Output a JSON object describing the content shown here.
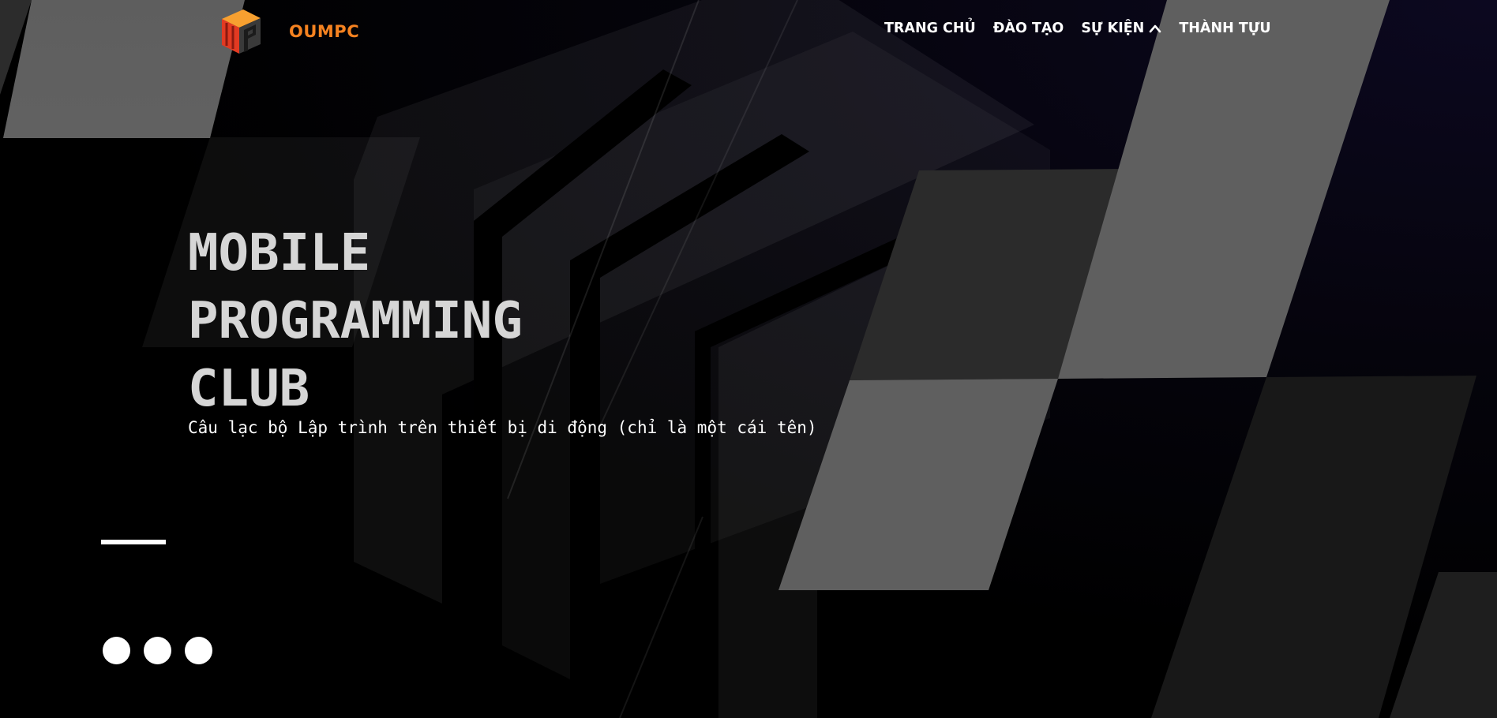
{
  "brand": {
    "name": "OUMPC",
    "logo_icon": "oumpc-cube-logo",
    "color": "#f58220"
  },
  "nav": {
    "items": [
      {
        "label": "TRANG CHỦ"
      },
      {
        "label": "ĐÀO TẠO"
      },
      {
        "label": "SỰ KIỆN",
        "icon": "chevron-up-icon"
      },
      {
        "label": "THÀNH TỰU"
      }
    ]
  },
  "hero": {
    "title_lines": [
      "MOBILE",
      "PROGRAMMING",
      "CLUB"
    ],
    "subtitle": "Câu lạc bộ Lập trình trên thiết bị di động (chỉ là một cái tên)"
  },
  "slider": {
    "dot_count": 3
  },
  "colors": {
    "background": "#000000",
    "title": "#d6d6d6",
    "text": "#ffffff",
    "accent": "#f58220"
  }
}
